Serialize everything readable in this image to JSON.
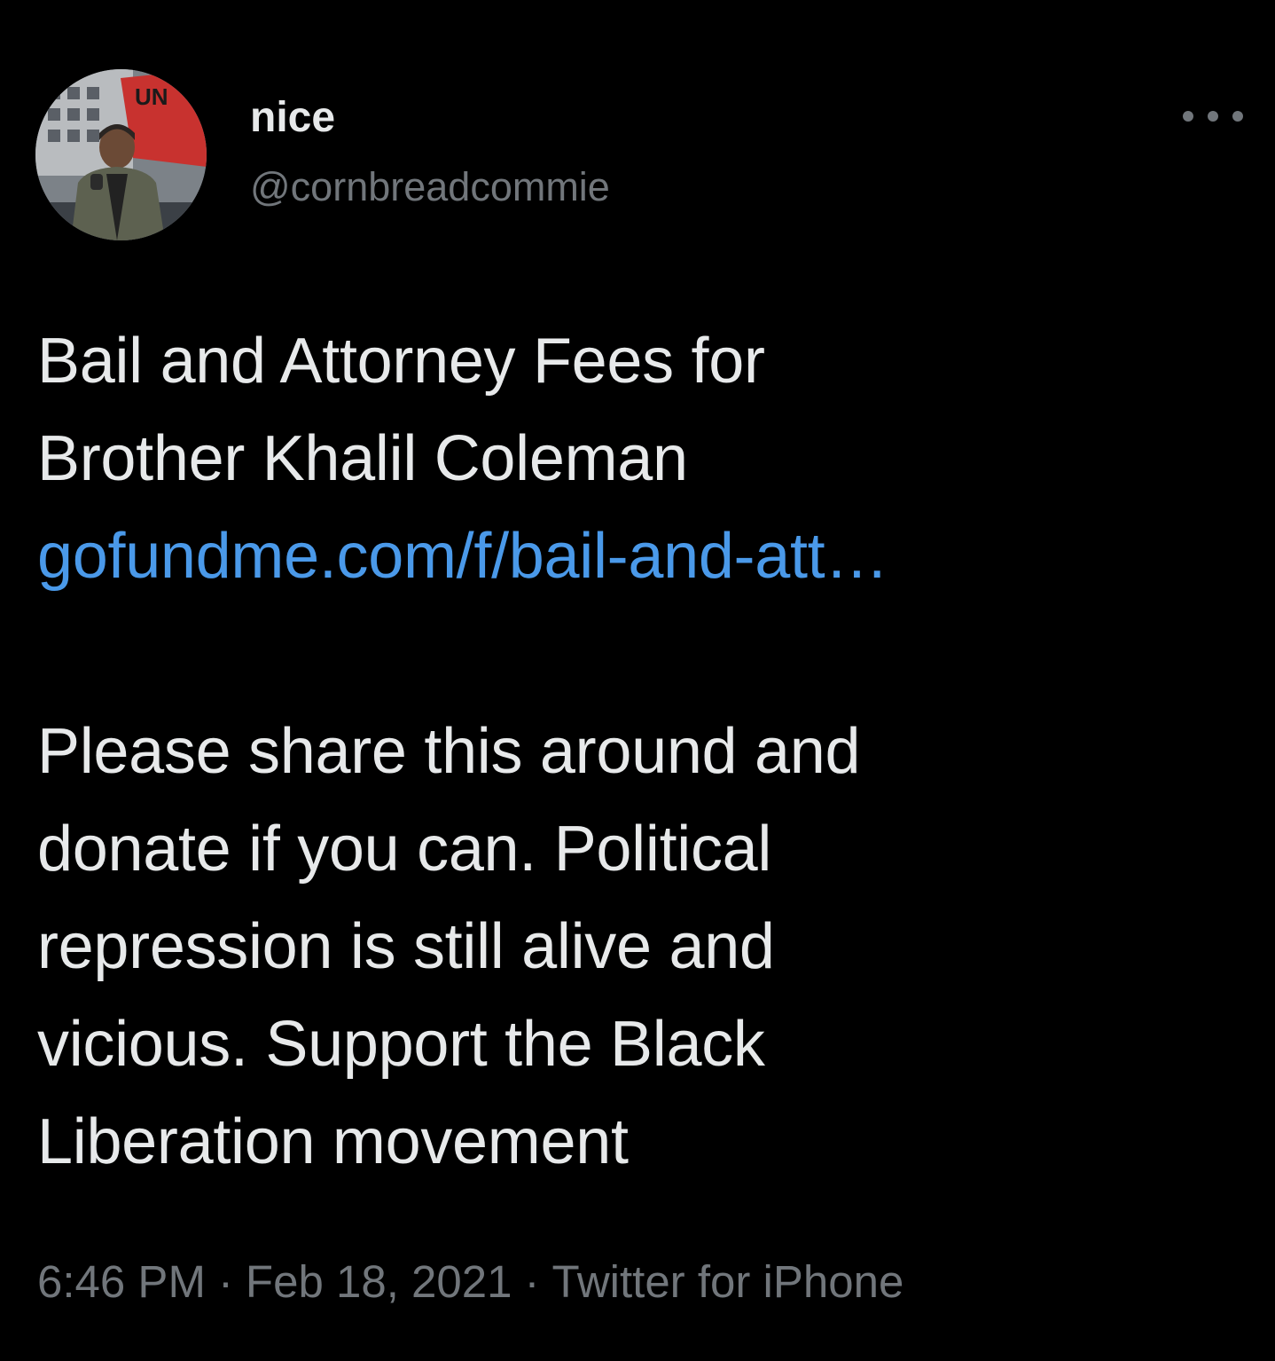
{
  "tweet": {
    "author": {
      "display_name": "nice",
      "handle": "@cornbreadcommie",
      "avatar": "profile-photo"
    },
    "more_icon": "more-horizontal-icon",
    "text_lines": [
      "Bail and Attorney Fees for",
      "Brother Khalil Coleman"
    ],
    "link": "gofundme.com/f/bail-and-att…",
    "text_lines_2": [
      "Please share this around and",
      "donate if you can. Political",
      "repression is still alive and",
      "vicious. Support the Black",
      "Liberation movement"
    ],
    "meta": {
      "time": "6:46 PM",
      "separator": "·",
      "date": "Feb 18, 2021",
      "source": "Twitter for iPhone"
    }
  },
  "colors": {
    "background": "#000000",
    "primary_text": "#e7e9ea",
    "secondary_text": "#71767b",
    "link": "#4a99e9"
  }
}
